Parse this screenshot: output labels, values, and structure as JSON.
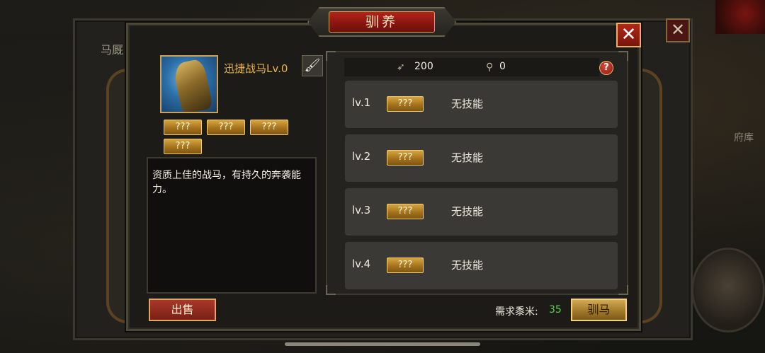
{
  "background": {
    "panel_title": "马厩",
    "side_hint": "府库",
    "back_close_glyph": "✕"
  },
  "dialog": {
    "title": "驯养",
    "close_glyph": "✕"
  },
  "horse": {
    "name": "迅捷战马Lv.0",
    "rename_icon": "brush-icon",
    "attributes": [
      "???",
      "???",
      "???",
      "???"
    ],
    "description": "资质上佳的战马，有持久的奔袭能力。"
  },
  "resources": [
    {
      "icon": "grain-icon",
      "value": "200"
    },
    {
      "icon": "medicine-icon",
      "value": "0"
    }
  ],
  "help_glyph": "?",
  "levels": [
    {
      "label": "lv.1",
      "badge": "???",
      "skill": "无技能"
    },
    {
      "label": "lv.2",
      "badge": "???",
      "skill": "无技能"
    },
    {
      "label": "lv.3",
      "badge": "???",
      "skill": "无技能"
    },
    {
      "label": "lv.4",
      "badge": "???",
      "skill": "无技能"
    }
  ],
  "footer": {
    "sell_label": "出售",
    "need_label": "需求黍米:",
    "need_value": "35",
    "tame_label": "驯马"
  },
  "colors": {
    "accent_gold": "#e7b34a",
    "title_red": "#b3241a",
    "need_green": "#5fd24a"
  }
}
